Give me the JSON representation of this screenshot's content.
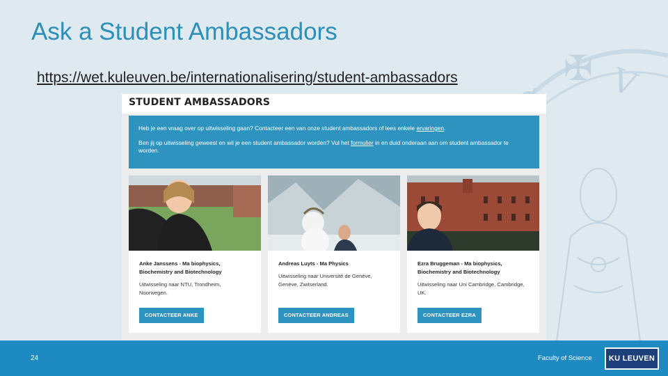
{
  "slide": {
    "title": "Ask a Student Ambassadors",
    "url": "https://wet.kuleuven.be/internationalisering/student-ambassadors",
    "page_number": "24",
    "faculty": "Faculty of Science",
    "logo_text": "KU LEUVEN"
  },
  "screenshot": {
    "heading": "STUDENT AMBASSADORS",
    "intro_line1_a": "Heb je een vraag over op uitwisseling gaan? Contacteer een van onze student ambassadors of lees enkele ",
    "intro_line1_link": "ervaringen",
    "intro_line1_b": ".",
    "intro_line2_a": "Ben jij op uitwisseling geweest en wil je een student ambassador worden? Vul het ",
    "intro_line2_link": "formulier",
    "intro_line2_b": " in en duid onderaan aan om student ambassador te worden.",
    "cards": [
      {
        "name": "Anke Janssens - Ma biophysics, Biochemistry and Biotechnology",
        "exchange": "Uitwisseling naar NTU, Trondheim, Noorwegen.",
        "button": "CONTACTEER ANKE"
      },
      {
        "name": "Andreas Luyts - Ma Physics",
        "exchange": "Uitwisseling naar Université de Genève, Genève, Zwitserland.",
        "button": "CONTACTEER ANDREAS"
      },
      {
        "name": "Ezra Bruggeman - Ma biophysics, Biochemistry and Biotechnology",
        "exchange": "Uitwisseling naar Uni Cambridge, Cambridge, UK.",
        "button": "CONTACTEER EZRA"
      }
    ]
  },
  "colors": {
    "title": "#2b8fb8",
    "accent": "#2e93bf",
    "footer": "#1d8ac2",
    "logo": "#1d3f7a"
  }
}
